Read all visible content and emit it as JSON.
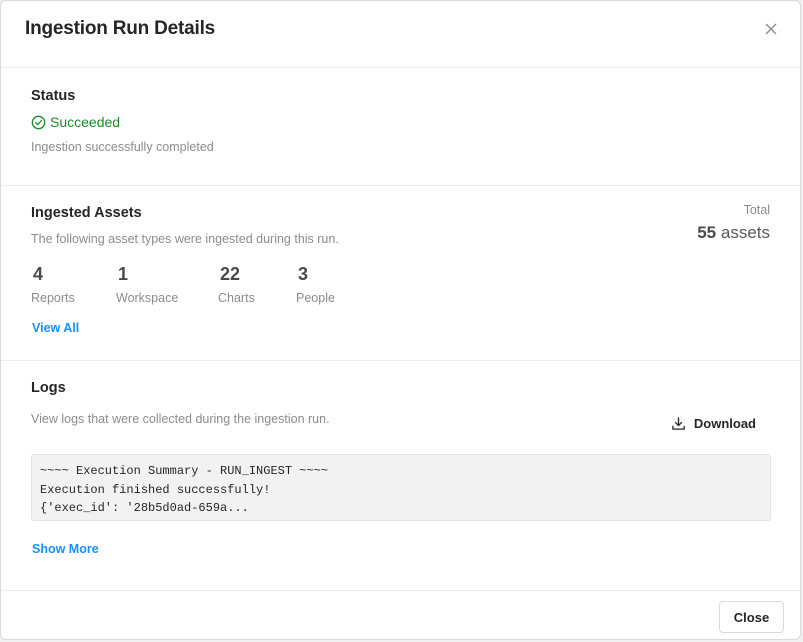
{
  "modal": {
    "title": "Ingestion Run Details"
  },
  "status": {
    "heading": "Status",
    "value": "Succeeded",
    "description": "Ingestion successfully completed",
    "color": "#1a8a2a"
  },
  "assets": {
    "heading": "Ingested Assets",
    "description": "The following asset types were ingested during this run.",
    "total_label": "Total",
    "total_count": "55",
    "total_unit": "assets",
    "items": [
      {
        "count": "4",
        "label": "Reports"
      },
      {
        "count": "1",
        "label": "Workspace"
      },
      {
        "count": "22",
        "label": "Charts"
      },
      {
        "count": "3",
        "label": "People"
      }
    ],
    "view_all": "View All"
  },
  "logs": {
    "heading": "Logs",
    "description": "View logs that were collected during the ingestion run.",
    "download_label": "Download",
    "lines": [
      "~~~~ Execution Summary - RUN_INGEST ~~~~",
      "Execution finished successfully!",
      "{'exec_id': '28b5d0ad-659a..."
    ],
    "show_more": "Show More"
  },
  "footer": {
    "close_label": "Close"
  },
  "icons": {
    "close": "close-icon",
    "status": "check-circle-icon",
    "download": "download-icon"
  },
  "colors": {
    "link": "#1890ff",
    "success": "#1a8a2a"
  }
}
